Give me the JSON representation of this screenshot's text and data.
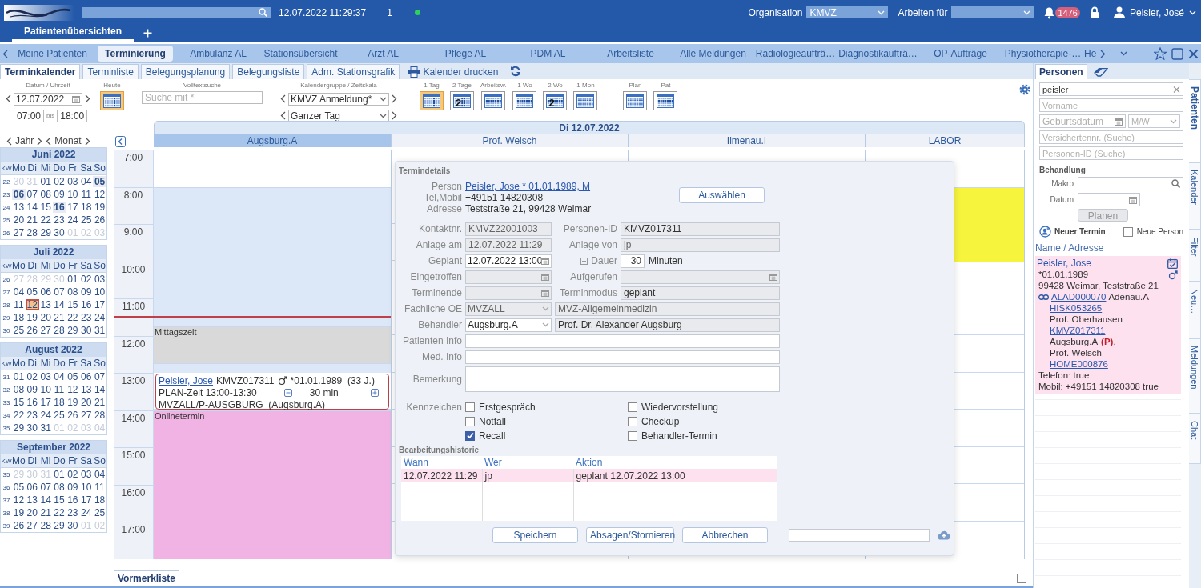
{
  "header": {
    "datetime": "12.07.2022 11:29:37",
    "session_count": "1",
    "online": true,
    "organisation_label": "Organisation",
    "organisation": "KMVZ",
    "work_for_label": "Arbeiten für",
    "notifications": "1476",
    "user": "Peisler, José"
  },
  "workspace_tabs": [
    {
      "label": "Patientenübersichten",
      "selected": true
    }
  ],
  "module_tabs": [
    {
      "label": "Meine Patienten",
      "selected": false
    },
    {
      "label": "Terminierung",
      "selected": true
    },
    {
      "label": "Ambulanz AL",
      "selected": false
    },
    {
      "label": "Stationsübersicht",
      "selected": false
    },
    {
      "label": "Arzt AL",
      "selected": false
    },
    {
      "label": "Pflege AL",
      "selected": false
    },
    {
      "label": "PDM AL",
      "selected": false
    },
    {
      "label": "Arbeitsliste",
      "selected": false
    },
    {
      "label": "Alle Meldungen",
      "selected": false
    },
    {
      "label": "Radiologieaufträ…",
      "selected": false
    },
    {
      "label": "Diagnostikaufträ…",
      "selected": false
    },
    {
      "label": "OP-Aufträge",
      "selected": false
    },
    {
      "label": "Physiotherapie-…",
      "selected": false
    },
    {
      "label": "He",
      "selected": false
    }
  ],
  "sub_tabs": [
    {
      "label": "Terminkalender",
      "selected": true
    },
    {
      "label": "Terminliste",
      "selected": false
    },
    {
      "label": "Belegungsplanung",
      "selected": false
    },
    {
      "label": "Belegungsliste",
      "selected": false
    },
    {
      "label": "Adm. Stationsgrafik",
      "selected": false
    }
  ],
  "print_label": "Kalender drucken",
  "toolbar": {
    "date_label": "Datum / Uhrzeit",
    "date": "12.07.2022",
    "time_from": "07:00",
    "bis": "bis",
    "time_to": "18:00",
    "today_label": "Heute",
    "search_label": "Volltextsuche",
    "search": {
      "placeholder": "Suche mit *"
    },
    "group_label": "Kalendergruppe / Zeitskala",
    "group": "KMVZ Anmeldung*",
    "scale": "Ganzer Tag",
    "views": [
      {
        "label": "1 Tag",
        "kind": "day",
        "selected": true
      },
      {
        "label": "2 Tage",
        "kind": "days",
        "badge": "2",
        "selected": false
      },
      {
        "label": "Arbeitsw.",
        "kind": "week",
        "selected": false
      },
      {
        "label": "1 Wo",
        "kind": "week",
        "selected": false
      },
      {
        "label": "2 Wo",
        "kind": "week",
        "badge": "2",
        "selected": false
      },
      {
        "label": "1 Mon",
        "kind": "month",
        "selected": false
      }
    ],
    "plan_views": [
      {
        "label": "Plan",
        "kind": "month",
        "selected": false
      },
      {
        "label": "Pat",
        "kind": "week",
        "selected": false
      }
    ]
  },
  "mini_nav": {
    "year": "Jahr",
    "month": "Monat"
  },
  "months": [
    {
      "title": "Juni 2022",
      "header": [
        "KW",
        "Mo",
        "Di",
        "Mi",
        "Do",
        "Fr",
        "Sa",
        "So"
      ],
      "weeks": [
        {
          "kw": "22",
          "days": [
            {
              "d": "30",
              "kind": "other"
            },
            {
              "d": "31",
              "kind": "other"
            },
            {
              "d": "01",
              "kind": "day"
            },
            {
              "d": "02",
              "kind": "day"
            },
            {
              "d": "03",
              "kind": "day"
            },
            {
              "d": "04",
              "kind": "day"
            },
            {
              "d": "05",
              "kind": "mark"
            }
          ]
        },
        {
          "kw": "23",
          "days": [
            {
              "d": "06",
              "kind": "mark"
            },
            {
              "d": "07",
              "kind": "day"
            },
            {
              "d": "08",
              "kind": "day"
            },
            {
              "d": "09",
              "kind": "day"
            },
            {
              "d": "10",
              "kind": "day"
            },
            {
              "d": "11",
              "kind": "day"
            },
            {
              "d": "12",
              "kind": "day"
            }
          ]
        },
        {
          "kw": "24",
          "days": [
            {
              "d": "13",
              "kind": "day"
            },
            {
              "d": "14",
              "kind": "day"
            },
            {
              "d": "15",
              "kind": "day"
            },
            {
              "d": "16",
              "kind": "mark"
            },
            {
              "d": "17",
              "kind": "day"
            },
            {
              "d": "18",
              "kind": "day"
            },
            {
              "d": "19",
              "kind": "day"
            }
          ]
        },
        {
          "kw": "25",
          "days": [
            {
              "d": "20",
              "kind": "day"
            },
            {
              "d": "21",
              "kind": "day"
            },
            {
              "d": "22",
              "kind": "day"
            },
            {
              "d": "23",
              "kind": "day"
            },
            {
              "d": "24",
              "kind": "day"
            },
            {
              "d": "25",
              "kind": "day"
            },
            {
              "d": "26",
              "kind": "day"
            }
          ]
        },
        {
          "kw": "26",
          "days": [
            {
              "d": "27",
              "kind": "day"
            },
            {
              "d": "28",
              "kind": "day"
            },
            {
              "d": "29",
              "kind": "day"
            },
            {
              "d": "30",
              "kind": "day"
            },
            {
              "d": "01",
              "kind": "other"
            },
            {
              "d": "02",
              "kind": "other"
            },
            {
              "d": "03",
              "kind": "other"
            }
          ]
        }
      ]
    },
    {
      "title": "Juli 2022",
      "header": [
        "KW",
        "Mo",
        "Di",
        "Mi",
        "Do",
        "Fr",
        "Sa",
        "So"
      ],
      "weeks": [
        {
          "kw": "26",
          "days": [
            {
              "d": "27",
              "kind": "other"
            },
            {
              "d": "28",
              "kind": "other"
            },
            {
              "d": "29",
              "kind": "other"
            },
            {
              "d": "30",
              "kind": "other"
            },
            {
              "d": "01",
              "kind": "day"
            },
            {
              "d": "02",
              "kind": "day"
            },
            {
              "d": "03",
              "kind": "day"
            }
          ]
        },
        {
          "kw": "27",
          "days": [
            {
              "d": "04",
              "kind": "day"
            },
            {
              "d": "05",
              "kind": "day"
            },
            {
              "d": "06",
              "kind": "day"
            },
            {
              "d": "07",
              "kind": "day"
            },
            {
              "d": "08",
              "kind": "day"
            },
            {
              "d": "09",
              "kind": "day"
            },
            {
              "d": "10",
              "kind": "day"
            }
          ]
        },
        {
          "kw": "28",
          "days": [
            {
              "d": "11",
              "kind": "day"
            },
            {
              "d": "12",
              "kind": "today"
            },
            {
              "d": "13",
              "kind": "day"
            },
            {
              "d": "14",
              "kind": "day"
            },
            {
              "d": "15",
              "kind": "day"
            },
            {
              "d": "16",
              "kind": "day"
            },
            {
              "d": "17",
              "kind": "day"
            }
          ]
        },
        {
          "kw": "29",
          "days": [
            {
              "d": "18",
              "kind": "day"
            },
            {
              "d": "19",
              "kind": "day"
            },
            {
              "d": "20",
              "kind": "day"
            },
            {
              "d": "21",
              "kind": "day"
            },
            {
              "d": "22",
              "kind": "day"
            },
            {
              "d": "23",
              "kind": "day"
            },
            {
              "d": "24",
              "kind": "day"
            }
          ]
        },
        {
          "kw": "30",
          "days": [
            {
              "d": "25",
              "kind": "day"
            },
            {
              "d": "26",
              "kind": "day"
            },
            {
              "d": "27",
              "kind": "day"
            },
            {
              "d": "28",
              "kind": "day"
            },
            {
              "d": "29",
              "kind": "day"
            },
            {
              "d": "30",
              "kind": "day"
            },
            {
              "d": "31",
              "kind": "day"
            }
          ]
        }
      ]
    },
    {
      "title": "August 2022",
      "header": [
        "KW",
        "Mo",
        "Di",
        "Mi",
        "Do",
        "Fr",
        "Sa",
        "So"
      ],
      "weeks": [
        {
          "kw": "31",
          "days": [
            {
              "d": "01",
              "kind": "day"
            },
            {
              "d": "02",
              "kind": "day"
            },
            {
              "d": "03",
              "kind": "day"
            },
            {
              "d": "04",
              "kind": "day"
            },
            {
              "d": "05",
              "kind": "day"
            },
            {
              "d": "06",
              "kind": "day"
            },
            {
              "d": "07",
              "kind": "day"
            }
          ]
        },
        {
          "kw": "32",
          "days": [
            {
              "d": "08",
              "kind": "day"
            },
            {
              "d": "09",
              "kind": "day"
            },
            {
              "d": "10",
              "kind": "day"
            },
            {
              "d": "11",
              "kind": "day"
            },
            {
              "d": "12",
              "kind": "day"
            },
            {
              "d": "13",
              "kind": "day"
            },
            {
              "d": "14",
              "kind": "day"
            }
          ]
        },
        {
          "kw": "33",
          "days": [
            {
              "d": "15",
              "kind": "day"
            },
            {
              "d": "16",
              "kind": "day"
            },
            {
              "d": "17",
              "kind": "day"
            },
            {
              "d": "18",
              "kind": "day"
            },
            {
              "d": "19",
              "kind": "day"
            },
            {
              "d": "20",
              "kind": "day"
            },
            {
              "d": "21",
              "kind": "day"
            }
          ]
        },
        {
          "kw": "34",
          "days": [
            {
              "d": "22",
              "kind": "day"
            },
            {
              "d": "23",
              "kind": "day"
            },
            {
              "d": "24",
              "kind": "day"
            },
            {
              "d": "25",
              "kind": "day"
            },
            {
              "d": "26",
              "kind": "day"
            },
            {
              "d": "27",
              "kind": "day"
            },
            {
              "d": "28",
              "kind": "day"
            }
          ]
        },
        {
          "kw": "35",
          "days": [
            {
              "d": "29",
              "kind": "day"
            },
            {
              "d": "30",
              "kind": "day"
            },
            {
              "d": "31",
              "kind": "day"
            },
            {
              "d": "01",
              "kind": "other"
            },
            {
              "d": "02",
              "kind": "other"
            },
            {
              "d": "03",
              "kind": "other"
            },
            {
              "d": "04",
              "kind": "other"
            }
          ]
        }
      ]
    },
    {
      "title": "September 2022",
      "header": [
        "KW",
        "Mo",
        "Di",
        "Mi",
        "Do",
        "Fr",
        "Sa",
        "So"
      ],
      "weeks": [
        {
          "kw": "35",
          "days": [
            {
              "d": "29",
              "kind": "other"
            },
            {
              "d": "30",
              "kind": "other"
            },
            {
              "d": "31",
              "kind": "other"
            },
            {
              "d": "01",
              "kind": "day"
            },
            {
              "d": "02",
              "kind": "day"
            },
            {
              "d": "03",
              "kind": "day"
            },
            {
              "d": "04",
              "kind": "day"
            }
          ]
        },
        {
          "kw": "36",
          "days": [
            {
              "d": "05",
              "kind": "day"
            },
            {
              "d": "06",
              "kind": "day"
            },
            {
              "d": "07",
              "kind": "day"
            },
            {
              "d": "08",
              "kind": "day"
            },
            {
              "d": "09",
              "kind": "day"
            },
            {
              "d": "10",
              "kind": "day"
            },
            {
              "d": "11",
              "kind": "day"
            }
          ]
        },
        {
          "kw": "37",
          "days": [
            {
              "d": "12",
              "kind": "day"
            },
            {
              "d": "13",
              "kind": "day"
            },
            {
              "d": "14",
              "kind": "day"
            },
            {
              "d": "15",
              "kind": "day"
            },
            {
              "d": "16",
              "kind": "day"
            },
            {
              "d": "17",
              "kind": "day"
            },
            {
              "d": "18",
              "kind": "day"
            }
          ]
        },
        {
          "kw": "38",
          "days": [
            {
              "d": "19",
              "kind": "day"
            },
            {
              "d": "20",
              "kind": "day"
            },
            {
              "d": "21",
              "kind": "day"
            },
            {
              "d": "22",
              "kind": "day"
            },
            {
              "d": "23",
              "kind": "day"
            },
            {
              "d": "24",
              "kind": "day"
            },
            {
              "d": "25",
              "kind": "day"
            }
          ]
        },
        {
          "kw": "39",
          "days": [
            {
              "d": "26",
              "kind": "day"
            },
            {
              "d": "27",
              "kind": "day"
            },
            {
              "d": "28",
              "kind": "day"
            },
            {
              "d": "29",
              "kind": "day"
            },
            {
              "d": "30",
              "kind": "day"
            },
            {
              "d": "01",
              "kind": "other"
            },
            {
              "d": "02",
              "kind": "other"
            }
          ]
        }
      ]
    }
  ],
  "calendar": {
    "title": "Di 12.07.2022",
    "hours": [
      "7:00",
      "8:00",
      "9:00",
      "10:00",
      "11:00",
      "12:00",
      "13:00",
      "14:00",
      "15:00",
      "16:00",
      "17:00"
    ],
    "columns": [
      {
        "name": "Augsburg.A",
        "selected": true,
        "quarter_slots": [
          {
            "kind": "open"
          },
          {
            "kind": "open"
          },
          {
            "kind": "open"
          },
          {
            "kind": "open"
          },
          {
            "kind": "free"
          },
          {
            "kind": "free"
          },
          {
            "kind": "free"
          },
          {
            "kind": "free"
          },
          {
            "kind": "free"
          },
          {
            "kind": "free"
          },
          {
            "kind": "free"
          },
          {
            "kind": "free"
          },
          {
            "kind": "free"
          },
          {
            "kind": "free"
          },
          {
            "kind": "free"
          },
          {
            "kind": "free"
          },
          {
            "kind": "free"
          },
          {
            "kind": "free"
          },
          {
            "kind": "now"
          },
          {
            "kind": "free"
          },
          {
            "kind": "break",
            "label": "Mittagszeit"
          },
          {
            "kind": "break"
          },
          {
            "kind": "break"
          },
          {
            "kind": "break"
          },
          {
            "kind": "free"
          },
          {
            "kind": "appointment",
            "patient": "Peisler, Jose",
            "info": "KMVZ017311",
            "birth": "*01.01.1989  (33 J.)",
            "plan": "PLAN-Zeit 13:00-13:30",
            "duration": "30 min",
            "unit": "MVZALL/P-AUSGBURG  (Augsburg.A)"
          },
          {
            "kind": "appointment"
          },
          {
            "kind": "appointment"
          },
          {
            "kind": "appointment"
          },
          {
            "kind": "online",
            "label": "Onlinetermin"
          },
          {
            "kind": "online"
          },
          {
            "kind": "online"
          },
          {
            "kind": "online"
          },
          {
            "kind": "online"
          },
          {
            "kind": "online"
          },
          {
            "kind": "online"
          },
          {
            "kind": "online"
          },
          {
            "kind": "online"
          },
          {
            "kind": "online"
          },
          {
            "kind": "online"
          },
          {
            "kind": "online"
          },
          {
            "kind": "online"
          },
          {
            "kind": "online"
          },
          {
            "kind": "online"
          },
          {
            "kind": "online"
          }
        ]
      },
      {
        "name": "Prof. Welsch",
        "selected": false
      },
      {
        "name": "Ilmenau.I",
        "selected": false
      },
      {
        "name": "LABOR",
        "selected": false,
        "quarter_slots": [
          {
            "kind": "open"
          },
          {
            "kind": "open"
          },
          {
            "kind": "open"
          },
          {
            "kind": "open"
          },
          {
            "kind": "busy"
          },
          {
            "kind": "busy"
          },
          {
            "kind": "busy"
          },
          {
            "kind": "busy"
          },
          {
            "kind": "busy"
          },
          {
            "kind": "busy"
          },
          {
            "kind": "busy"
          },
          {
            "kind": "busy"
          }
        ]
      }
    ]
  },
  "dialog": {
    "title": "Termindetails",
    "person_rows": [
      {
        "label": "Person",
        "value": "Peisler, Jose * 01.01.1989, M",
        "kind": "link"
      },
      {
        "label": "Tel,Mobil",
        "value": "+49151 14820308",
        "kind": "text"
      },
      {
        "label": "Adresse",
        "value": "Teststraße 21, 99428 Weimar",
        "kind": "text"
      }
    ],
    "select_button": "Auswählen",
    "form": [
      {
        "label": "Kontaktnr.",
        "field": {
          "kind": "text",
          "value": "KMVZ22001003",
          "disabled": true
        },
        "label2": "Personen-ID",
        "field2": {
          "kind": "text",
          "value": "KMVZ017311",
          "disabled": false
        }
      },
      {
        "label": "Anlage am",
        "field": {
          "kind": "text",
          "value": "12.07.2022 11:29",
          "disabled": true
        },
        "label2": "Anlage von",
        "field2": {
          "kind": "text",
          "value": "jp",
          "disabled": true
        }
      },
      {
        "label": "Geplant",
        "field": {
          "kind": "date",
          "value": "12.07.2022 13:00",
          "disabled": false
        },
        "label2": "Dauer",
        "field2": {
          "kind": "number",
          "value": "30",
          "unit": "Minuten",
          "disabled": false
        }
      },
      {
        "label": "Eingetroffen",
        "field": {
          "kind": "date",
          "disabled": true
        },
        "label2": "Aufgerufen",
        "field2": {
          "kind": "date",
          "disabled": true
        }
      },
      {
        "label": "Terminende",
        "field": {
          "kind": "date",
          "disabled": true
        },
        "label2": "Terminmodus",
        "field2": {
          "kind": "text",
          "value": "geplant",
          "disabled": false
        }
      },
      {
        "label": "Fachliche OE",
        "field": {
          "kind": "select",
          "value": "MVZALL",
          "disabled": true
        },
        "field2": {
          "kind": "text",
          "value": "MVZ-Allgemeinmedizin",
          "disabled": true
        }
      },
      {
        "label": "Behandler",
        "field": {
          "kind": "select",
          "value": "Augsburg.A",
          "disabled": false
        },
        "field2": {
          "kind": "text",
          "value": "Prof. Dr. Alexander Augsburg",
          "disabled": false
        }
      },
      {
        "label": "Patienten Info",
        "field": {
          "kind": "input"
        }
      },
      {
        "label": "Med. Info",
        "field": {
          "kind": "input"
        }
      },
      {
        "label": "Bemerkung",
        "field": {
          "kind": "textarea"
        }
      }
    ],
    "flags_label": "Kennzeichen",
    "flags": [
      {
        "label": "Erstgespräch",
        "checked": false
      },
      {
        "label": "Wiedervorstellung",
        "checked": false
      },
      {
        "label": "Notfall",
        "checked": false
      },
      {
        "label": "Checkup",
        "checked": false
      },
      {
        "label": "Recall",
        "checked": true
      },
      {
        "label": "Behandler-Termin",
        "checked": false
      }
    ],
    "history": {
      "title": "Bearbeitungshistorie",
      "columns": [
        "Wann",
        "Wer",
        "Aktion"
      ],
      "rows": [
        {
          "cells": [
            "12.07.2022 11:29",
            "jp",
            "geplant 12.07.2022 13:00"
          ],
          "selected": true
        }
      ]
    },
    "buttons": [
      "Speichern",
      "Absagen/Stornieren",
      "Abbrechen"
    ]
  },
  "right_panel": {
    "tabs": [
      {
        "label": "Personen",
        "selected": true
      }
    ],
    "search_rows": [
      [
        {
          "kind": "search",
          "value": "peisler"
        }
      ],
      [
        {
          "kind": "text",
          "placeholder": "Vorname"
        }
      ],
      [
        {
          "kind": "date",
          "placeholder": "Geburtsdatum"
        },
        {
          "kind": "select",
          "placeholder": "M/W"
        }
      ],
      [
        {
          "kind": "text",
          "placeholder": "Versichertennr. (Suche)"
        }
      ],
      [
        {
          "kind": "text",
          "placeholder": "Personen-ID (Suche)"
        }
      ]
    ],
    "treatment": {
      "title": "Behandlung",
      "macro_label": "Makro",
      "date_label": "Datum",
      "plan_button": "Planen",
      "new_appointment": "Neuer Termin",
      "new_person": {
        "label": "Neue Person",
        "checked": false
      }
    },
    "results_header": "Name / Adresse",
    "results": [
      {
        "selected": true,
        "name": "Peisler, Jose",
        "birth": "*01.01.1989",
        "address": "99428 Weimar, Teststraße 21",
        "lines": [
          {
            "kind": "link",
            "text": "ALAD000070",
            "suffix": "Adenau.A"
          },
          {
            "kind": "link",
            "text": "HISK053265"
          },
          {
            "kind": "text",
            "text": "Prof. Oberhausen"
          },
          {
            "kind": "link",
            "text": "KMVZ017311"
          },
          {
            "kind": "text",
            "text": "Augsburg.A",
            "flag": "(P)",
            "suffix": ","
          },
          {
            "kind": "text",
            "text": "Prof. Welsch"
          },
          {
            "kind": "link",
            "text": "HOME000876"
          }
        ],
        "phone": "Telefon: true",
        "mobile": "Mobil: +49151 14820308 true"
      }
    ]
  },
  "side_tabs": [
    {
      "label": "Patienten",
      "selected": true
    },
    {
      "label": "Kalender",
      "selected": false
    },
    {
      "label": "Filter",
      "selected": false
    },
    {
      "label": "Neu…",
      "selected": false
    },
    {
      "label": "Meldungen",
      "selected": false
    },
    {
      "label": "Chat",
      "selected": false
    }
  ],
  "footer_tabs": [
    {
      "label": "Vormerkliste",
      "selected": true
    }
  ],
  "footer_checkbox": {
    "checked": false
  }
}
